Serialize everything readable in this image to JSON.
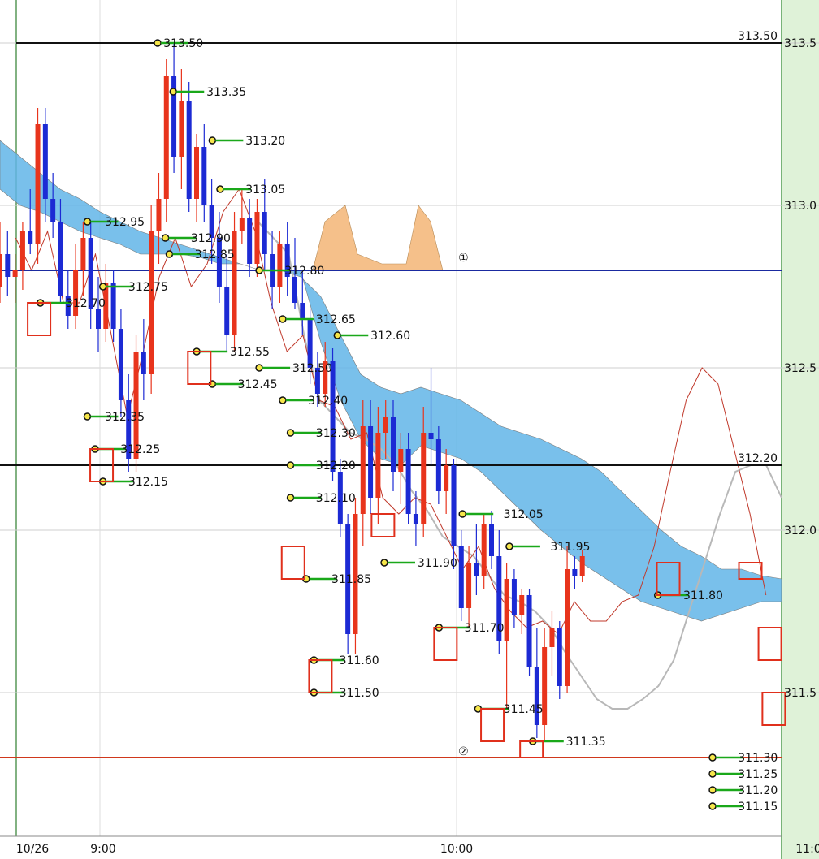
{
  "chart_data": {
    "type": "candlestick",
    "x_axis": {
      "tick_labels": [
        "10/26",
        "9:00",
        "10:00",
        "11:0"
      ]
    },
    "y_axis": {
      "ylim": [
        311.0,
        313.6
      ],
      "grid": true,
      "right_labels": [
        "313.5",
        "313.0",
        "312.5",
        "312.0",
        "311.5"
      ]
    },
    "colors": {
      "up": "#e8341c",
      "down": "#1c2ad4",
      "cloud": "#62b5e8",
      "cloud_alt": "#f5c08a",
      "span_line": "#b8b8b8",
      "lag_line": "#c0392b",
      "level_black": "#111111",
      "level_blue": "#1a2aa0",
      "level_red": "#d0381c",
      "marker_green": "#1aa81a",
      "marker_yellow": "#f6e64a",
      "box_red": "#e0301c",
      "right_panel": "#dff2d8"
    },
    "horizontal_levels": [
      {
        "price": 313.5,
        "color": "level_black",
        "label": "313.50"
      },
      {
        "price": 312.8,
        "color": "level_blue",
        "label": ""
      },
      {
        "price": 312.2,
        "color": "level_black",
        "label": "312.20"
      },
      {
        "price": 311.3,
        "color": "level_red",
        "label": ""
      }
    ],
    "circled_marks": [
      {
        "text": "①",
        "t": 0.593,
        "price": 312.84
      },
      {
        "text": "②",
        "t": 0.593,
        "price": 311.32
      }
    ],
    "price_labels": [
      "313.50",
      "313.35",
      "313.20",
      "313.05",
      "312.95",
      "312.90",
      "312.85",
      "312.80",
      "312.75",
      "312.70",
      "312.65",
      "312.60",
      "312.55",
      "312.50",
      "312.45",
      "312.40",
      "312.35",
      "312.30",
      "312.25",
      "312.20",
      "312.15",
      "312.10",
      "312.05",
      "311.95",
      "311.90",
      "311.85",
      "311.80",
      "311.70",
      "311.60",
      "311.50",
      "311.45",
      "311.35",
      "311.30",
      "311.25",
      "311.20",
      "311.15"
    ],
    "candles": [
      {
        "o": 312.75,
        "h": 312.95,
        "l": 312.7,
        "c": 312.85
      },
      {
        "o": 312.85,
        "h": 312.92,
        "l": 312.72,
        "c": 312.78
      },
      {
        "o": 312.78,
        "h": 312.85,
        "l": 312.7,
        "c": 312.8
      },
      {
        "o": 312.8,
        "h": 312.95,
        "l": 312.74,
        "c": 312.92
      },
      {
        "o": 312.92,
        "h": 313.05,
        "l": 312.85,
        "c": 312.88
      },
      {
        "o": 312.88,
        "h": 313.3,
        "l": 312.82,
        "c": 313.25
      },
      {
        "o": 313.25,
        "h": 313.3,
        "l": 312.95,
        "c": 313.02
      },
      {
        "o": 313.02,
        "h": 313.1,
        "l": 312.9,
        "c": 312.95
      },
      {
        "o": 312.95,
        "h": 313.02,
        "l": 312.7,
        "c": 312.72
      },
      {
        "o": 312.72,
        "h": 312.8,
        "l": 312.62,
        "c": 312.66
      },
      {
        "o": 312.66,
        "h": 312.88,
        "l": 312.62,
        "c": 312.8
      },
      {
        "o": 312.8,
        "h": 312.95,
        "l": 312.72,
        "c": 312.9
      },
      {
        "o": 312.9,
        "h": 312.95,
        "l": 312.62,
        "c": 312.68
      },
      {
        "o": 312.68,
        "h": 312.78,
        "l": 312.55,
        "c": 312.62
      },
      {
        "o": 312.62,
        "h": 312.82,
        "l": 312.58,
        "c": 312.76
      },
      {
        "o": 312.76,
        "h": 312.8,
        "l": 312.58,
        "c": 312.62
      },
      {
        "o": 312.62,
        "h": 312.68,
        "l": 312.35,
        "c": 312.4
      },
      {
        "o": 312.4,
        "h": 312.48,
        "l": 312.18,
        "c": 312.22
      },
      {
        "o": 312.22,
        "h": 312.6,
        "l": 312.18,
        "c": 312.55
      },
      {
        "o": 312.55,
        "h": 312.65,
        "l": 312.4,
        "c": 312.48
      },
      {
        "o": 312.48,
        "h": 313.0,
        "l": 312.42,
        "c": 312.92
      },
      {
        "o": 312.92,
        "h": 313.1,
        "l": 312.82,
        "c": 313.02
      },
      {
        "o": 313.02,
        "h": 313.45,
        "l": 312.95,
        "c": 313.4
      },
      {
        "o": 313.4,
        "h": 313.5,
        "l": 313.1,
        "c": 313.15
      },
      {
        "o": 313.15,
        "h": 313.42,
        "l": 313.05,
        "c": 313.32
      },
      {
        "o": 313.32,
        "h": 313.38,
        "l": 312.98,
        "c": 313.02
      },
      {
        "o": 313.02,
        "h": 313.22,
        "l": 312.95,
        "c": 313.18
      },
      {
        "o": 313.18,
        "h": 313.25,
        "l": 312.95,
        "c": 313.0
      },
      {
        "o": 313.0,
        "h": 313.08,
        "l": 312.82,
        "c": 312.9
      },
      {
        "o": 312.9,
        "h": 312.98,
        "l": 312.7,
        "c": 312.75
      },
      {
        "o": 312.75,
        "h": 312.85,
        "l": 312.55,
        "c": 312.6
      },
      {
        "o": 312.6,
        "h": 312.98,
        "l": 312.55,
        "c": 312.92
      },
      {
        "o": 312.92,
        "h": 313.05,
        "l": 312.88,
        "c": 312.96
      },
      {
        "o": 312.96,
        "h": 313.02,
        "l": 312.78,
        "c": 312.82
      },
      {
        "o": 312.82,
        "h": 313.02,
        "l": 312.78,
        "c": 312.98
      },
      {
        "o": 312.98,
        "h": 313.08,
        "l": 312.8,
        "c": 312.85
      },
      {
        "o": 312.85,
        "h": 312.92,
        "l": 312.68,
        "c": 312.75
      },
      {
        "o": 312.75,
        "h": 312.92,
        "l": 312.7,
        "c": 312.88
      },
      {
        "o": 312.88,
        "h": 312.95,
        "l": 312.72,
        "c": 312.78
      },
      {
        "o": 312.78,
        "h": 312.9,
        "l": 312.68,
        "c": 312.7
      },
      {
        "o": 312.7,
        "h": 312.8,
        "l": 312.6,
        "c": 312.65
      },
      {
        "o": 312.65,
        "h": 312.68,
        "l": 312.45,
        "c": 312.5
      },
      {
        "o": 312.5,
        "h": 312.55,
        "l": 312.38,
        "c": 312.42
      },
      {
        "o": 312.42,
        "h": 312.58,
        "l": 312.38,
        "c": 312.52
      },
      {
        "o": 312.52,
        "h": 312.56,
        "l": 312.15,
        "c": 312.18
      },
      {
        "o": 312.18,
        "h": 312.22,
        "l": 311.98,
        "c": 312.02
      },
      {
        "o": 312.02,
        "h": 312.05,
        "l": 311.62,
        "c": 311.68
      },
      {
        "o": 311.68,
        "h": 312.1,
        "l": 311.62,
        "c": 312.05
      },
      {
        "o": 312.05,
        "h": 312.4,
        "l": 311.95,
        "c": 312.32
      },
      {
        "o": 312.32,
        "h": 312.4,
        "l": 312.05,
        "c": 312.1
      },
      {
        "o": 312.1,
        "h": 312.38,
        "l": 312.02,
        "c": 312.3
      },
      {
        "o": 312.3,
        "h": 312.4,
        "l": 312.22,
        "c": 312.35
      },
      {
        "o": 312.35,
        "h": 312.4,
        "l": 312.12,
        "c": 312.18
      },
      {
        "o": 312.18,
        "h": 312.3,
        "l": 312.08,
        "c": 312.25
      },
      {
        "o": 312.25,
        "h": 312.3,
        "l": 312.02,
        "c": 312.05
      },
      {
        "o": 312.05,
        "h": 312.12,
        "l": 311.95,
        "c": 312.02
      },
      {
        "o": 312.02,
        "h": 312.38,
        "l": 311.98,
        "c": 312.3
      },
      {
        "o": 312.3,
        "h": 312.5,
        "l": 312.2,
        "c": 312.28
      },
      {
        "o": 312.28,
        "h": 312.32,
        "l": 312.08,
        "c": 312.12
      },
      {
        "o": 312.12,
        "h": 312.25,
        "l": 312.05,
        "c": 312.2
      },
      {
        "o": 312.2,
        "h": 312.22,
        "l": 311.88,
        "c": 311.95
      },
      {
        "o": 311.95,
        "h": 312.0,
        "l": 311.72,
        "c": 311.76
      },
      {
        "o": 311.76,
        "h": 311.95,
        "l": 311.7,
        "c": 311.9
      },
      {
        "o": 311.9,
        "h": 312.02,
        "l": 311.8,
        "c": 311.86
      },
      {
        "o": 311.86,
        "h": 312.05,
        "l": 311.82,
        "c": 312.02
      },
      {
        "o": 312.02,
        "h": 312.06,
        "l": 311.88,
        "c": 311.92
      },
      {
        "o": 311.92,
        "h": 312.0,
        "l": 311.62,
        "c": 311.66
      },
      {
        "o": 311.66,
        "h": 311.9,
        "l": 311.45,
        "c": 311.85
      },
      {
        "o": 311.85,
        "h": 311.88,
        "l": 311.7,
        "c": 311.74
      },
      {
        "o": 311.74,
        "h": 311.82,
        "l": 311.68,
        "c": 311.8
      },
      {
        "o": 311.8,
        "h": 311.82,
        "l": 311.55,
        "c": 311.58
      },
      {
        "o": 311.58,
        "h": 311.7,
        "l": 311.36,
        "c": 311.4
      },
      {
        "o": 311.4,
        "h": 311.7,
        "l": 311.35,
        "c": 311.64
      },
      {
        "o": 311.64,
        "h": 311.75,
        "l": 311.55,
        "c": 311.7
      },
      {
        "o": 311.7,
        "h": 311.72,
        "l": 311.48,
        "c": 311.52
      },
      {
        "o": 311.52,
        "h": 311.95,
        "l": 311.5,
        "c": 311.88
      },
      {
        "o": 311.88,
        "h": 311.92,
        "l": 311.82,
        "c": 311.86
      },
      {
        "o": 311.86,
        "h": 311.94,
        "l": 311.84,
        "c": 311.92
      }
    ],
    "cloud_upper": [
      313.05,
      313.0,
      312.98,
      312.95,
      312.92,
      312.9,
      312.88,
      312.85,
      312.85,
      312.85,
      312.84,
      312.82,
      312.82,
      312.8,
      312.8,
      312.78,
      312.72,
      312.6,
      312.48,
      312.44,
      312.42,
      312.44,
      312.42,
      312.4,
      312.36,
      312.32,
      312.3,
      312.28,
      312.25,
      312.22,
      312.18,
      312.12,
      312.06,
      312.0,
      311.95,
      311.92,
      311.88,
      311.88,
      311.86,
      311.85
    ],
    "cloud_lower": [
      313.2,
      313.15,
      313.1,
      313.05,
      313.02,
      312.98,
      312.95,
      312.92,
      312.9,
      312.88,
      312.86,
      312.84,
      312.82,
      312.8,
      312.8,
      312.8,
      312.58,
      312.4,
      312.28,
      312.22,
      312.2,
      312.26,
      312.24,
      312.22,
      312.18,
      312.12,
      312.06,
      312.0,
      311.95,
      311.9,
      311.86,
      311.82,
      311.78,
      311.76,
      311.74,
      311.72,
      311.74,
      311.76,
      311.78,
      311.78
    ],
    "lag_line": [
      312.9,
      312.8,
      312.92,
      312.7,
      312.7,
      312.85,
      312.6,
      312.35,
      312.55,
      312.78,
      312.9,
      312.75,
      312.82,
      312.98,
      313.05,
      312.92,
      312.7,
      312.55,
      312.6,
      312.4,
      312.38,
      312.28,
      312.3,
      312.1,
      312.05,
      312.1,
      312.08,
      311.98,
      311.88,
      311.95,
      311.82,
      311.75,
      311.7,
      311.72,
      311.68,
      311.78,
      311.72,
      311.72,
      311.78,
      311.8,
      311.95,
      312.18,
      312.4,
      312.5,
      312.45,
      312.25,
      312.05,
      311.8
    ],
    "span_line": [
      312.95,
      312.9,
      312.85,
      312.6,
      312.4,
      312.35,
      312.3,
      312.28,
      312.25,
      312.2,
      312.12,
      312.06,
      311.98,
      311.95,
      311.92,
      311.86,
      311.8,
      311.78,
      311.75,
      311.7,
      311.62,
      311.55,
      311.48,
      311.45,
      311.45,
      311.48,
      311.52,
      311.6,
      311.75,
      311.9,
      312.05,
      312.18,
      312.2,
      312.2,
      312.1
    ]
  }
}
